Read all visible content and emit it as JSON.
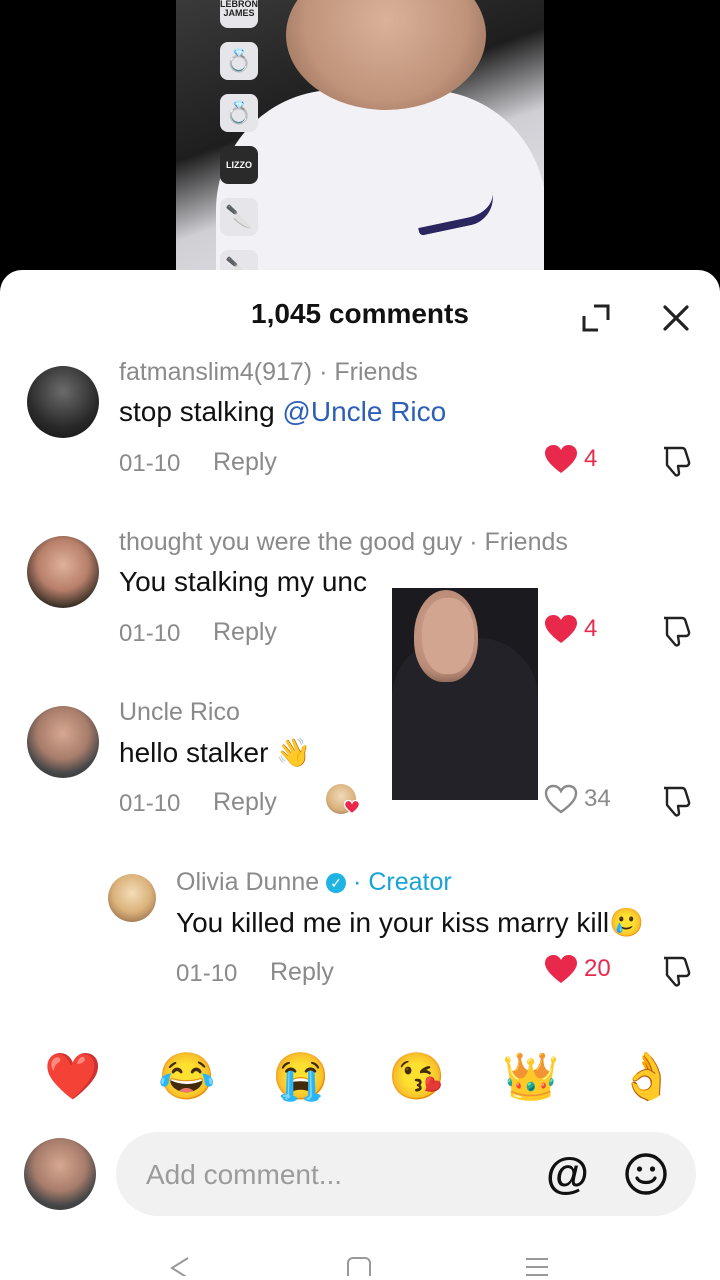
{
  "video": {
    "rank_first_label": "LEBRON JAMES",
    "rank_person_label": "LIZZO"
  },
  "sheet": {
    "title": "1,045 comments"
  },
  "comments": [
    {
      "username": "fatmanslim4(917)",
      "tag": "Friends",
      "text": "stop stalking ",
      "mention": "@Uncle Rico",
      "date": "01-10",
      "reply": "Reply",
      "likes": "4"
    },
    {
      "username": "thought you were the good guy",
      "tag": "Friends",
      "text": "You stalking my unc",
      "date": "01-10",
      "reply": "Reply",
      "likes": "4"
    },
    {
      "username": "Uncle Rico",
      "text": "hello stalker 👋",
      "date": "01-10",
      "reply": "Reply",
      "likes": "34"
    },
    {
      "username": "Olivia Dunne",
      "tag": "Creator",
      "text": "You killed me in your kiss marry kill🥲",
      "date": "01-10",
      "reply": "Reply",
      "likes": "20"
    }
  ],
  "emoji_bar": [
    "❤️",
    "😂",
    "😭",
    "😘",
    "👑",
    "👌"
  ],
  "input": {
    "placeholder": "Add comment..."
  },
  "colors": {
    "like_red": "#e8294c",
    "creator_blue": "#1aa4d6",
    "mention_blue": "#2d5fb8"
  }
}
